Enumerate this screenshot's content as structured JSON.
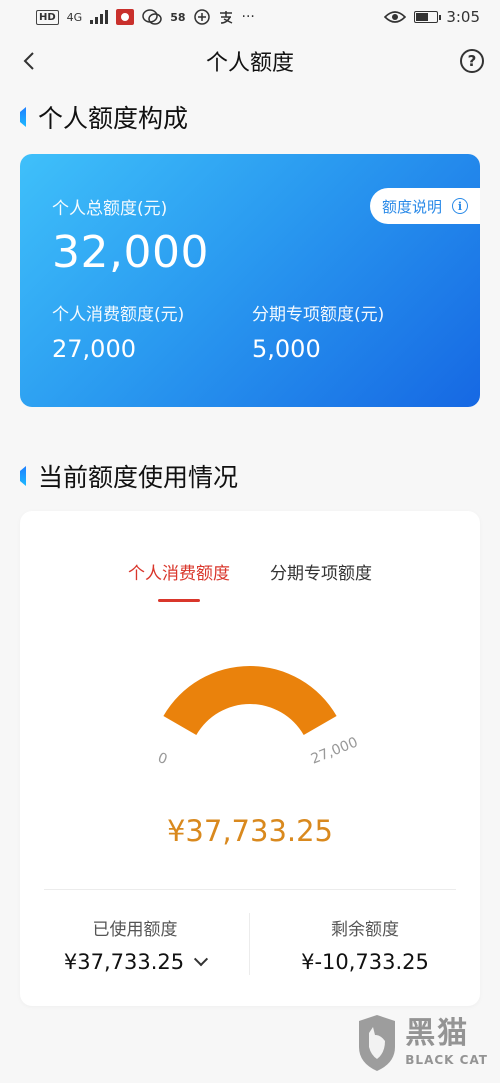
{
  "status_bar": {
    "hd": "HD",
    "network": "4G",
    "extra": "58",
    "time": "3:05"
  },
  "navbar": {
    "title": "个人额度",
    "help_icon": "?"
  },
  "section1": {
    "title": "个人额度构成"
  },
  "quota_card": {
    "total_label": "个人总额度(元)",
    "total_value": "32,000",
    "consumer_label": "个人消费额度(元)",
    "consumer_value": "27,000",
    "installment_label": "分期专项额度(元)",
    "installment_value": "5,000",
    "explain_label": "额度说明",
    "colors": {
      "gradient_start": "#3fc0fa",
      "gradient_end": "#1668e3"
    }
  },
  "section2": {
    "title": "当前额度使用情况"
  },
  "usage_card": {
    "tabs": [
      {
        "label": "个人消费额度",
        "active": true
      },
      {
        "label": "分期专项额度",
        "active": false
      }
    ],
    "gauge": {
      "min_label": "0",
      "max_label": "27,000",
      "used_fraction": 1.0,
      "fill_color": "#ea820c"
    },
    "used_amount": "¥37,733.25",
    "used_label": "已使用额度",
    "used_value": "¥37,733.25",
    "remaining_label": "剩余额度",
    "remaining_value": "¥-10,733.25",
    "accent_color": "#d9362b"
  },
  "watermark": {
    "cn": "黑猫",
    "en": "BLACK CAT"
  }
}
